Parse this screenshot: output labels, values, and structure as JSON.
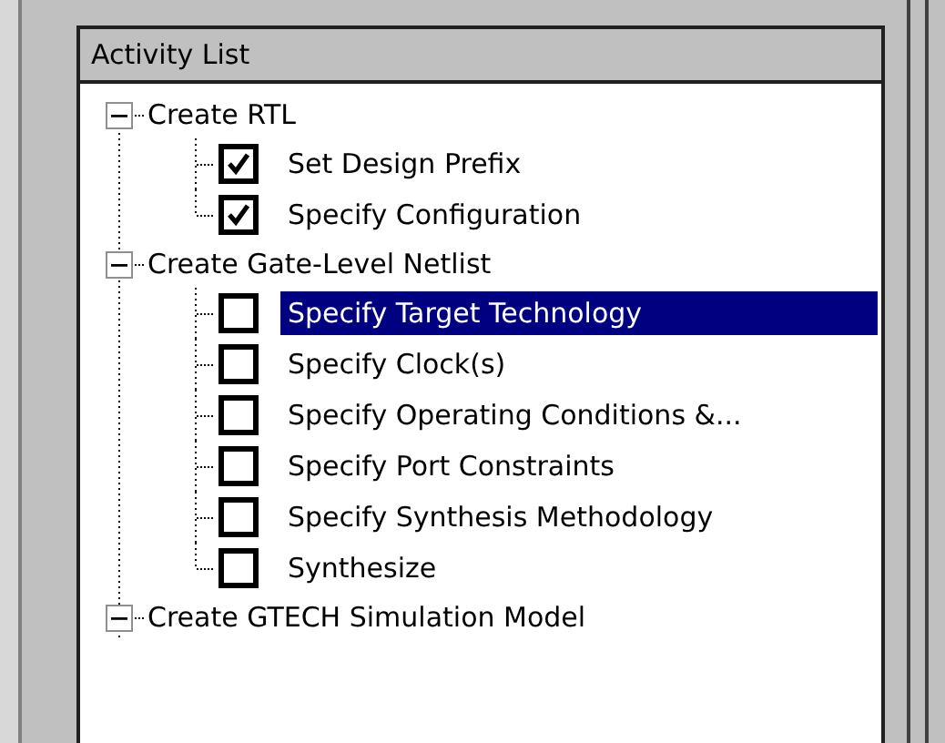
{
  "panel": {
    "title": "Activity List"
  },
  "groups": [
    {
      "label": "Create RTL",
      "expanded": true,
      "children": [
        {
          "label": "Set Design Prefix",
          "checked": true,
          "selected": false
        },
        {
          "label": "Specify Configuration",
          "checked": true,
          "selected": false
        }
      ]
    },
    {
      "label": "Create Gate-Level Netlist",
      "expanded": true,
      "children": [
        {
          "label": "Specify Target Technology",
          "checked": false,
          "selected": true
        },
        {
          "label": "Specify Clock(s)",
          "checked": false,
          "selected": false
        },
        {
          "label": "Specify Operating Conditions &...",
          "checked": false,
          "selected": false
        },
        {
          "label": "Specify Port Constraints",
          "checked": false,
          "selected": false
        },
        {
          "label": "Specify Synthesis Methodology",
          "checked": false,
          "selected": false
        },
        {
          "label": "Synthesize",
          "checked": false,
          "selected": false
        }
      ]
    },
    {
      "label": "Create GTECH Simulation Model",
      "expanded": true
    }
  ]
}
